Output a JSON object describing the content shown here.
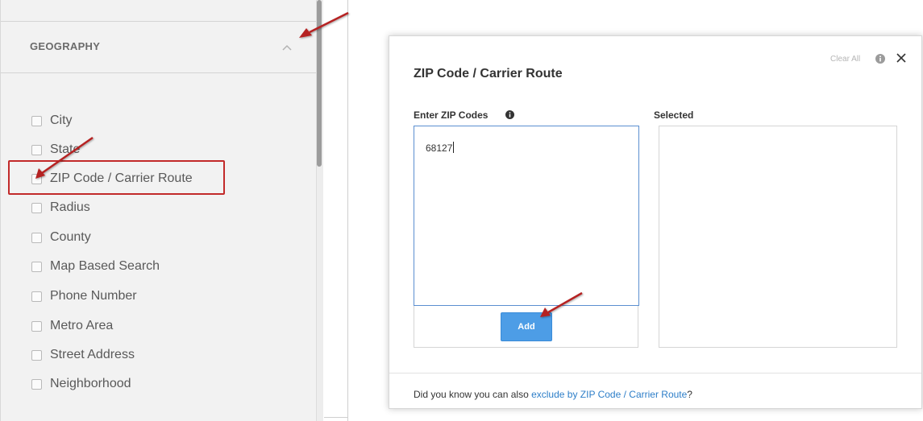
{
  "sidebar": {
    "section_title": "GEOGRAPHY",
    "options": [
      {
        "label": "City"
      },
      {
        "label": "State"
      },
      {
        "label": "ZIP Code / Carrier Route"
      },
      {
        "label": "Radius"
      },
      {
        "label": "County"
      },
      {
        "label": "Map Based Search"
      },
      {
        "label": "Phone Number"
      },
      {
        "label": "Metro Area"
      },
      {
        "label": "Street Address"
      },
      {
        "label": "Neighborhood"
      }
    ]
  },
  "modal": {
    "title": "ZIP Code / Carrier Route",
    "clear_all": "Clear All",
    "enter_label": "Enter ZIP Codes",
    "zip_value": "68127",
    "selected_label": "Selected",
    "add_button": "Add",
    "footer_text": "Did you know you can also ",
    "footer_link": "exclude by ZIP Code / Carrier Route",
    "footer_end": "?"
  },
  "icons": {
    "collapse": "chevron-up-icon",
    "info": "info-circle-icon",
    "close": "close-icon",
    "annotation": "red-arrow-icon"
  },
  "colors": {
    "accent": "#4d9de6",
    "link": "#2d7ec8",
    "highlight": "#c22a2a",
    "sidebar_bg": "#f2f2f2"
  }
}
